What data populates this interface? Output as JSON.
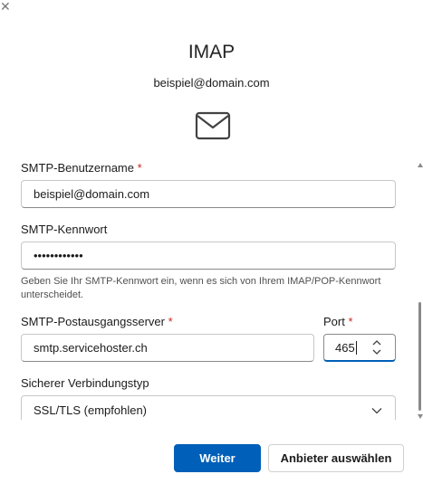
{
  "header": {
    "title": "IMAP",
    "email": "beispiel@domain.com"
  },
  "form": {
    "smtp_username": {
      "label": "SMTP-Benutzername",
      "required_mark": "*",
      "value": "beispiel@domain.com"
    },
    "smtp_password": {
      "label": "SMTP-Kennwort",
      "value": "••••••••••••",
      "hint": "Geben Sie Ihr SMTP-Kennwort ein, wenn es sich von Ihrem IMAP/POP-Kennwort unterscheidet."
    },
    "smtp_server": {
      "label": "SMTP-Postausgangsserver",
      "required_mark": "*",
      "value": "smtp.servicehoster.ch"
    },
    "port": {
      "label": "Port",
      "required_mark": "*",
      "value": "465"
    },
    "security": {
      "label": "Sicherer Verbindungstyp",
      "value": "SSL/TLS (empfohlen)"
    }
  },
  "buttons": {
    "next": "Weiter",
    "choose_provider": "Anbieter auswählen"
  },
  "colors": {
    "accent": "#005fb8",
    "required": "#c42b1c"
  },
  "icons": {
    "mail": "mail-icon",
    "chevron": "chevron-down-icon",
    "spinner": "spin-button-icon"
  }
}
